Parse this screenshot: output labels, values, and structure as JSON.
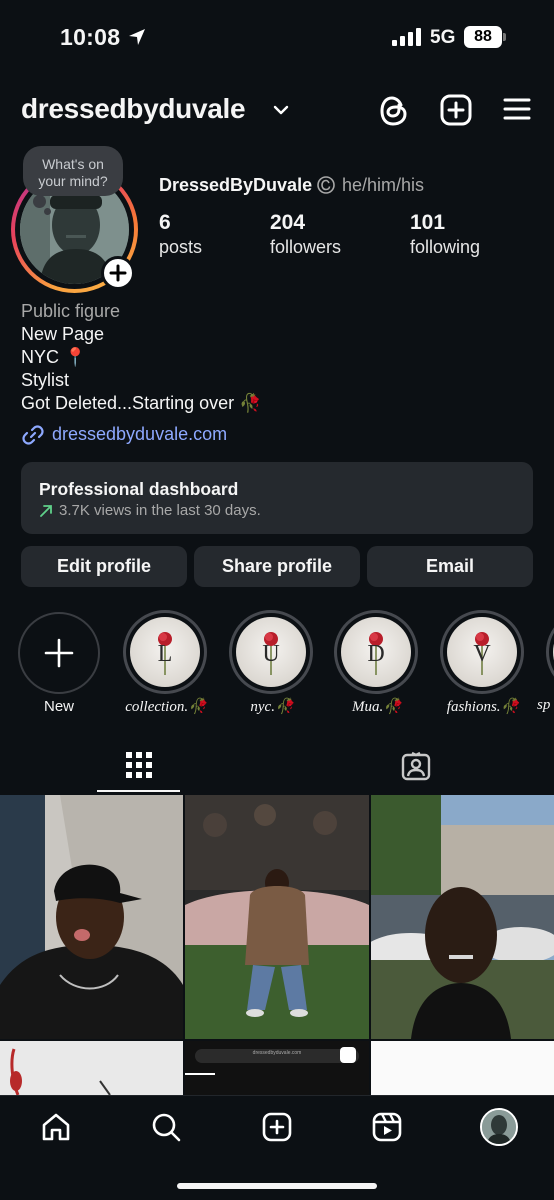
{
  "status_bar": {
    "time": "10:08",
    "network": "5G",
    "battery": "88"
  },
  "header": {
    "username": "dressedbyduvale",
    "icons": [
      "threads-icon",
      "new-post-icon",
      "menu-icon"
    ]
  },
  "profile": {
    "note_bubble": [
      "What's on",
      "your mind?"
    ],
    "display_name": "DressedByDuvale",
    "pronouns": "he/him/his",
    "stats": [
      {
        "num": "6",
        "label": "posts"
      },
      {
        "num": "204",
        "label": "followers"
      },
      {
        "num": "101",
        "label": "following"
      }
    ],
    "category": "Public figure",
    "bio_lines": [
      "New Page",
      "NYC 📍",
      "Stylist",
      "Got Deleted...Starting over 🥀"
    ],
    "link": "dressedbyduvale.com"
  },
  "dashboard": {
    "title": "Professional dashboard",
    "subtitle": "3.7K views in the last 30 days."
  },
  "buttons": {
    "edit": "Edit profile",
    "share": "Share profile",
    "email": "Email"
  },
  "highlights": {
    "new_label": "New",
    "items": [
      {
        "letter": "L",
        "label": "collection.🥀"
      },
      {
        "letter": "U",
        "label": "nyc.🥀"
      },
      {
        "letter": "D",
        "label": "Mua.🥀"
      },
      {
        "letter": "V",
        "label": "fashions.🥀"
      },
      {
        "letter": "",
        "label": "sp"
      }
    ]
  },
  "tabs": [
    "posts-grid-tab",
    "tagged-tab"
  ],
  "grid_preview": {
    "posts_url_text": "dressedbyduvale.com"
  },
  "bottom_nav": [
    "home",
    "search",
    "create",
    "reels",
    "profile"
  ],
  "colors": {
    "background": "#0c1014",
    "surface": "#25292e",
    "link": "#8ea9ff",
    "muted": "#a8a8a8",
    "dashboard_arrow": "#5fd08a"
  }
}
